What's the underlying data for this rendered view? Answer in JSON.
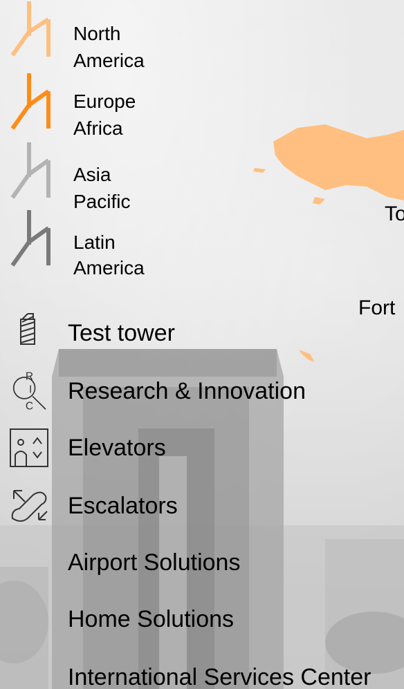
{
  "legend": {
    "regions": [
      {
        "line1": "North",
        "line2": "America",
        "color": "#FFBF80"
      },
      {
        "line1": "Europe",
        "line2": "Africa",
        "color": "#FF8C1A"
      },
      {
        "line1": "Asia",
        "line2": "Pacific",
        "color": "#B3B3B3"
      },
      {
        "line1": "Latin",
        "line2": "America",
        "color": "#7A7A7A"
      }
    ]
  },
  "categories": [
    {
      "label": "Test tower",
      "icon": "test-tower-icon"
    },
    {
      "label": "Research & Innovation",
      "icon": "research-innovation-icon",
      "icon_letters": [
        "R",
        "I",
        "C"
      ]
    },
    {
      "label": "Elevators",
      "icon": "elevator-icon"
    },
    {
      "label": "Escalators",
      "icon": "escalator-icon"
    },
    {
      "label": "Airport Solutions",
      "icon": ""
    },
    {
      "label": "Home Solutions",
      "icon": ""
    },
    {
      "label": "International Services Center",
      "icon": ""
    }
  ],
  "map": {
    "labels": [
      "To",
      "Fort"
    ],
    "land_color": "#FFBF80"
  }
}
